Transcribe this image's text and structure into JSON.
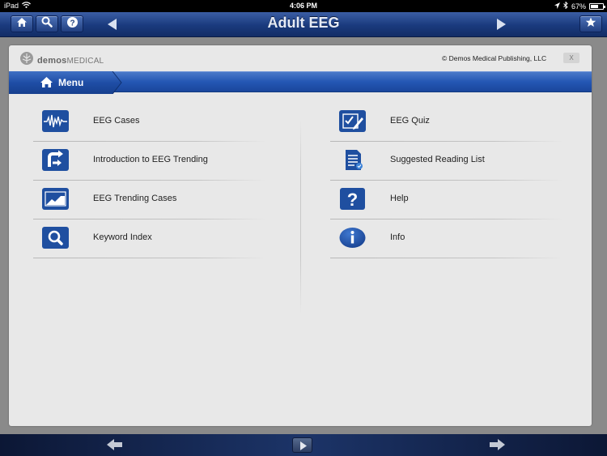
{
  "status_bar": {
    "device": "iPad",
    "time": "4:06 PM",
    "battery": "67%",
    "battery_level": 0.67
  },
  "top_bar": {
    "title": "Adult EEG"
  },
  "panel": {
    "logo": {
      "bold": "demos",
      "rest": "MEDICAL"
    },
    "copyright": "© Demos Medical Publishing, LLC",
    "close_label": "X"
  },
  "menu": {
    "title": "Menu"
  },
  "left_items": [
    {
      "label": "EEG Cases",
      "icon": "waveform-icon"
    },
    {
      "label": "Introduction to EEG Trending",
      "icon": "trending-intro-icon"
    },
    {
      "label": "EEG Trending Cases",
      "icon": "trend-chart-icon"
    },
    {
      "label": "Keyword Index",
      "icon": "search-icon"
    }
  ],
  "right_items": [
    {
      "label": "EEG Quiz",
      "icon": "quiz-icon"
    },
    {
      "label": "Suggested Reading List",
      "icon": "document-icon"
    },
    {
      "label": "Help",
      "icon": "question-icon"
    },
    {
      "label": "Info",
      "icon": "info-icon"
    }
  ],
  "colors": {
    "accent": "#2457b4",
    "icon_blue": "#1f4fa0",
    "top_bar": "#1a3a7d"
  }
}
